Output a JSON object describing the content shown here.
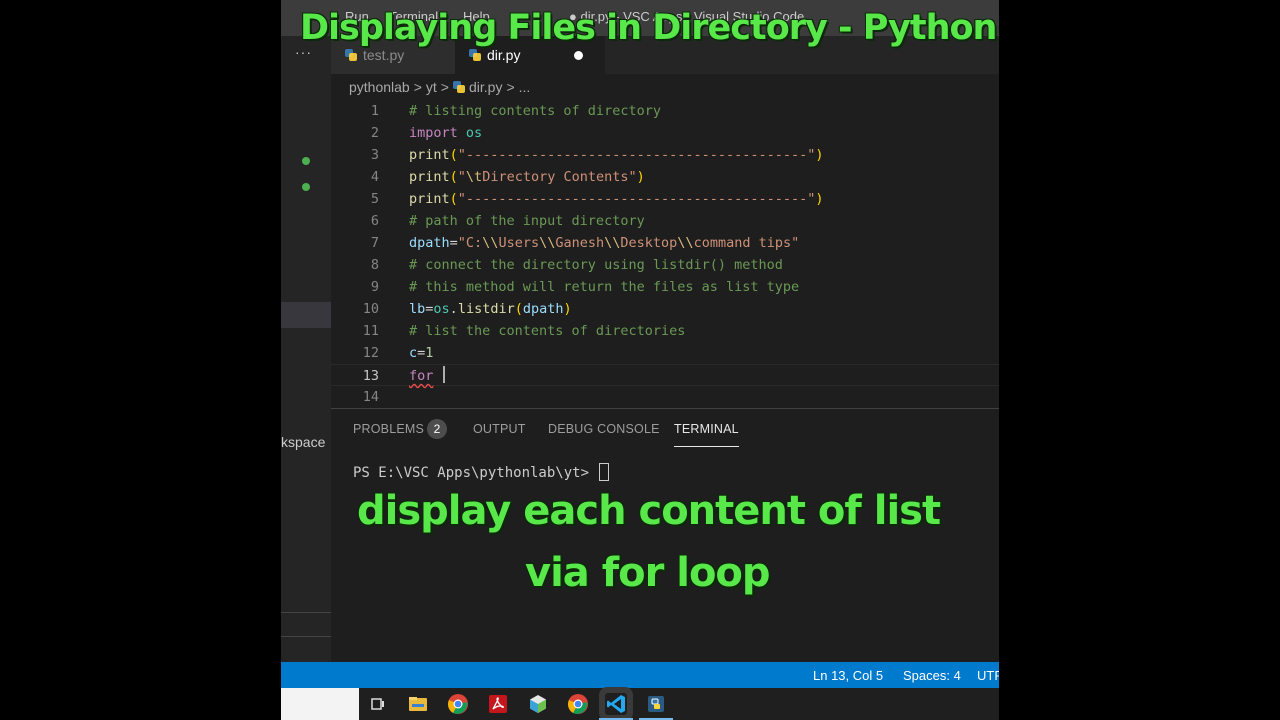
{
  "overlay": {
    "title": "Displaying Files in Directory - Python",
    "caption_line1": "display each content of list",
    "caption_line2": "via for loop"
  },
  "titlebar": {
    "menu": [
      "Run",
      "Terminal",
      "Help"
    ],
    "window_title": "● dir.py - VSC Apps - Visual Studio Code"
  },
  "sidebar": {
    "more": "···",
    "workspace_label": "kspace"
  },
  "tabs": [
    {
      "label": "test.py",
      "active": false
    },
    {
      "label": "dir.py",
      "active": true,
      "modified": true
    }
  ],
  "breadcrumb": [
    "pythonlab",
    ">",
    "yt",
    ">",
    "dir.py",
    ">",
    "..."
  ],
  "code": [
    {
      "n": "1",
      "text": "# listing contents of directory"
    },
    {
      "n": "2",
      "text": "import os"
    },
    {
      "n": "3",
      "text": "print(\"------------------------------------------\")"
    },
    {
      "n": "4",
      "text": "print(\"\\tDirectory Contents\")"
    },
    {
      "n": "5",
      "text": "print(\"------------------------------------------\")"
    },
    {
      "n": "6",
      "text": "# path of the input directory"
    },
    {
      "n": "7",
      "text": "dpath=\"C:\\\\Users\\\\Ganesh\\\\Desktop\\\\command tips\""
    },
    {
      "n": "8",
      "text": "# connect the directory using listdir() method"
    },
    {
      "n": "9",
      "text": "# this method will return the files as list type"
    },
    {
      "n": "10",
      "text": "lb=os.listdir(dpath)"
    },
    {
      "n": "11",
      "text": "# list the contents of directories"
    },
    {
      "n": "12",
      "text": "c=1"
    },
    {
      "n": "13",
      "text": "for "
    },
    {
      "n": "14",
      "text": ""
    }
  ],
  "panel": {
    "tabs": [
      "PROBLEMS",
      "OUTPUT",
      "DEBUG CONSOLE",
      "TERMINAL"
    ],
    "problems_count": "2",
    "active_tab": "TERMINAL",
    "terminal_prompt": "PS E:\\VSC Apps\\pythonlab\\yt>"
  },
  "statusbar": {
    "position": "Ln 13, Col 5",
    "spaces": "Spaces: 4",
    "encoding": "UTF"
  },
  "taskbar": {
    "icons": [
      "task-view-icon",
      "file-explorer-icon",
      "chrome-icon",
      "acrobat-icon",
      "3d-app-icon",
      "chrome-icon",
      "vscode-icon",
      "python-app-icon"
    ]
  },
  "colors": {
    "overlay_text": "#59e84a",
    "comment": "#6a9955",
    "keyword": "#c586c0",
    "function": "#dcdcaa",
    "string": "#ce9178",
    "variable": "#9cdcfe",
    "number": "#b5cea8",
    "module": "#4ec9b0",
    "statusbar": "#007acc"
  }
}
